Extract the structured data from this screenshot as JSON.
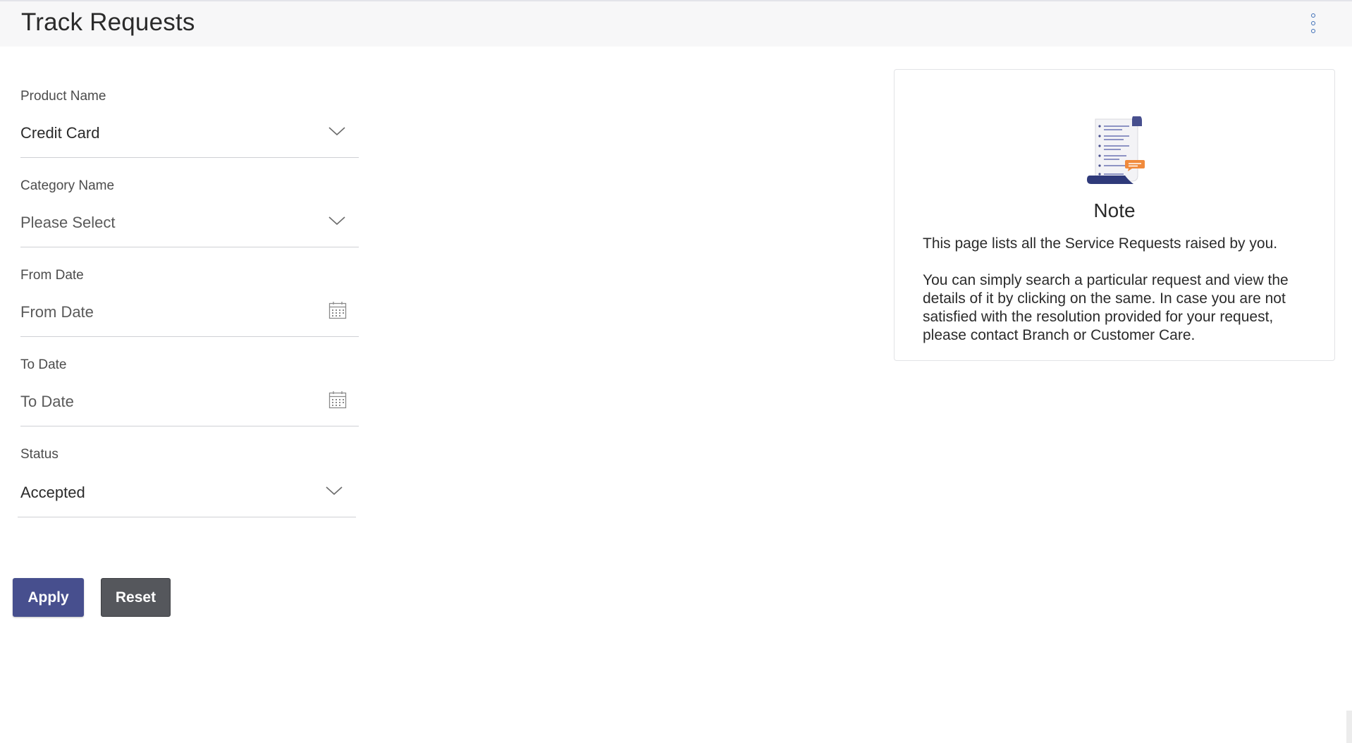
{
  "header": {
    "title": "Track Requests",
    "menu_icon": "more-vertical-icon"
  },
  "form": {
    "product": {
      "label": "Product Name",
      "value": "Credit Card",
      "icon": "chevron-down-icon"
    },
    "category": {
      "label": "Category Name",
      "value": "Please Select",
      "icon": "chevron-down-icon"
    },
    "from_date": {
      "label": "From Date",
      "placeholder": "From Date",
      "icon": "calendar-icon"
    },
    "to_date": {
      "label": "To Date",
      "placeholder": "To Date",
      "icon": "calendar-icon"
    },
    "status": {
      "label": "Status",
      "value": "Accepted",
      "icon": "chevron-down-icon"
    }
  },
  "buttons": {
    "apply": "Apply",
    "reset": "Reset"
  },
  "note": {
    "title": "Note",
    "paragraph1": "This page lists all the Service Requests raised by you.",
    "paragraph2": "You can simply search a particular request and view the details of it by clicking on the same. In case you are not satisfied with the resolution provided for your request, please contact Branch or Customer Care.",
    "illustration": "document-list-illustration"
  },
  "colors": {
    "primary_button": "#474f8e",
    "secondary_button": "#55575c",
    "accent_icon": "#3f6fb7",
    "header_bg": "#f7f7f8"
  }
}
